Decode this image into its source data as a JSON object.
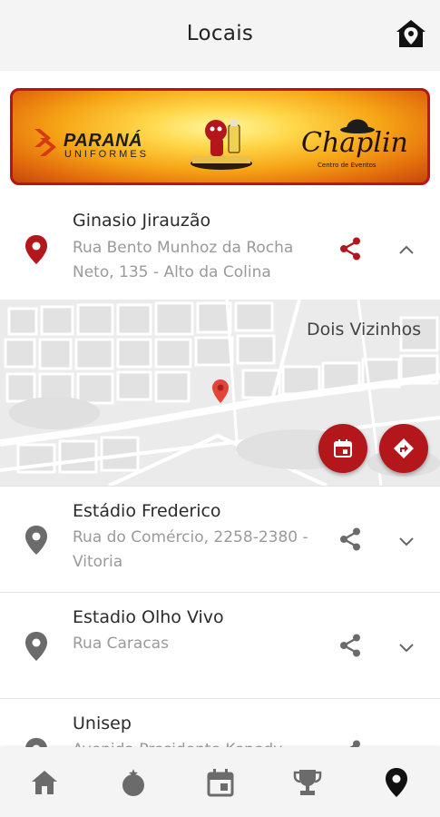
{
  "header": {
    "title": "Locais",
    "action_icon": "home-pin-icon"
  },
  "banner": {
    "sponsor1_name": "PARANÁ",
    "sponsor1_sub": "UNIFORMES",
    "sponsor2_name": "Chaplin",
    "sponsor2_sub": "Centro de Eventos"
  },
  "locations": [
    {
      "name": "Ginasio Jirauzão",
      "address": "Rua Bento Munhoz da Rocha Neto, 135 - Alto da Colina",
      "expanded": true,
      "color": "#b3161b"
    },
    {
      "name": "Estádio Frederico",
      "address": "Rua do Comércio, 2258-2380 - Vitoria",
      "expanded": false
    },
    {
      "name": "Estadio Olho Vivo",
      "address": "Rua Caracas",
      "expanded": false
    },
    {
      "name": "Unisep",
      "address": "Avenida Presidente Kenedy",
      "expanded": false
    }
  ],
  "map": {
    "city_label": "Dois Vizinhos",
    "fab_calendar_icon": "calendar-icon",
    "fab_directions_icon": "directions-icon"
  },
  "bottom_nav": [
    {
      "icon": "home-icon",
      "active": false
    },
    {
      "icon": "ball-icon",
      "active": false
    },
    {
      "icon": "calendar-icon",
      "active": false
    },
    {
      "icon": "trophy-icon",
      "active": false
    },
    {
      "icon": "location-pin-icon",
      "active": true
    }
  ],
  "colors": {
    "accent": "#b3161b",
    "inactive_icon": "#6b6b6b",
    "active_icon": "#111111"
  }
}
